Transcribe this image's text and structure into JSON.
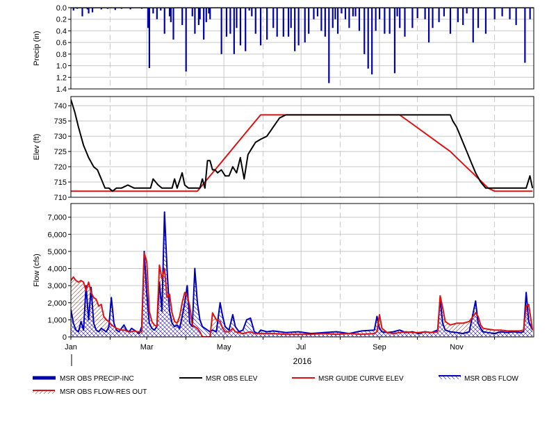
{
  "colors": {
    "precip": "#0000aa",
    "obs_elev": "#000000",
    "guide_curve": "#dd1111",
    "obs_flow": "#0000bb",
    "res_out": "#dd1111",
    "grid": "#c8c8c8"
  },
  "chart_data": [
    {
      "type": "bar",
      "ylabel": "Precip (in)",
      "ylim": [
        0.0,
        1.4
      ],
      "y_inverted": true,
      "yticks": [
        "0.0",
        "0.2",
        "0.4",
        "0.6",
        "0.8",
        "1.0",
        "1.2",
        "1.4"
      ],
      "grid": true,
      "series": [
        {
          "name": "MSR OBS PRECIP-INC",
          "x_day": [
            2,
            5,
            9,
            13,
            14,
            17,
            24,
            29,
            35,
            40,
            47,
            56,
            61,
            62,
            65,
            68,
            71,
            74,
            78,
            79,
            81,
            88,
            91,
            96,
            98,
            101,
            102,
            105,
            107,
            109,
            110,
            119,
            123,
            126,
            129,
            131,
            134,
            138,
            141,
            143,
            146,
            150,
            155,
            160,
            163,
            168,
            172,
            174,
            177,
            180,
            185,
            188,
            192,
            195,
            198,
            201,
            204,
            207,
            209,
            211,
            214,
            217,
            220,
            223,
            225,
            228,
            232,
            235,
            238,
            241,
            244,
            248,
            252,
            256,
            258,
            260,
            264,
            270,
            274,
            280,
            283,
            286,
            291,
            295,
            300,
            306,
            310,
            313,
            318,
            322,
            328,
            335,
            341,
            347,
            352,
            359,
            363
          ],
          "values": [
            0.05,
            0.02,
            0.15,
            0.03,
            0.1,
            0.08,
            0.03,
            0.02,
            0.04,
            0.02,
            0.03,
            0.02,
            0.35,
            1.04,
            0.1,
            0.2,
            0.05,
            0.45,
            0.15,
            0.25,
            0.55,
            0.3,
            1.1,
            0.15,
            0.45,
            0.3,
            0.2,
            0.55,
            0.25,
            0.1,
            0.2,
            0.8,
            0.5,
            0.45,
            0.8,
            0.35,
            0.65,
            0.75,
            0.05,
            0.15,
            0.45,
            0.65,
            0.55,
            0.35,
            0.5,
            0.5,
            0.5,
            0.35,
            0.75,
            0.65,
            0.6,
            0.45,
            0.2,
            0.15,
            0.4,
            0.5,
            1.3,
            0.35,
            0.2,
            0.45,
            0.1,
            0.2,
            0.35,
            0.15,
            0.15,
            0.4,
            0.8,
            1.05,
            1.15,
            0.4,
            0.2,
            0.45,
            0.45,
            1.13,
            0.15,
            0.35,
            0.5,
            0.35,
            0.18,
            0.2,
            0.6,
            0.35,
            0.25,
            0.15,
            0.45,
            0.25,
            0.3,
            0.1,
            0.6,
            0.35,
            0.45,
            0.2,
            0.15,
            0.2,
            0.3,
            0.95,
            0.2
          ]
        }
      ]
    },
    {
      "type": "line",
      "ylabel": "Elev (ft)",
      "ylim": [
        710,
        743
      ],
      "yticks": [
        "710",
        "715",
        "720",
        "725",
        "730",
        "735",
        "740"
      ],
      "grid": true,
      "series": [
        {
          "name": "MSR OBS ELEV",
          "x_day": [
            0,
            3,
            6,
            10,
            14,
            18,
            21,
            24,
            27,
            30,
            33,
            36,
            40,
            45,
            50,
            55,
            58,
            60,
            63,
            65,
            69,
            72,
            75,
            78,
            80,
            82,
            84,
            88,
            90,
            93,
            96,
            99,
            102,
            104,
            106,
            108,
            110,
            112,
            114,
            116,
            119,
            122,
            125,
            128,
            131,
            134,
            137,
            140,
            143,
            146,
            150,
            155,
            160,
            165,
            170,
            180,
            200,
            220,
            240,
            245,
            250,
            260,
            270,
            280,
            290,
            300,
            302,
            305,
            308,
            311,
            314,
            317,
            320,
            324,
            328,
            332,
            336,
            340,
            344,
            348,
            352,
            356,
            360,
            363,
            365
          ],
          "values": [
            742,
            738,
            733,
            727,
            723,
            720,
            719,
            716,
            713,
            713,
            712,
            713,
            713,
            714,
            713,
            713,
            713,
            713,
            713,
            716,
            714,
            713,
            713,
            713,
            713,
            716,
            713,
            718,
            714,
            713,
            713,
            713,
            713,
            716,
            713,
            722,
            722,
            719,
            719,
            718,
            719,
            717,
            717,
            720,
            718,
            723,
            716,
            724,
            726,
            728,
            729,
            730,
            733,
            736,
            737,
            737,
            737,
            737,
            737,
            737,
            737,
            737,
            737,
            737,
            737,
            737,
            735,
            733,
            730,
            727,
            724,
            721,
            718,
            715,
            713,
            713,
            713,
            713,
            713,
            713,
            713,
            713,
            713,
            717,
            713
          ]
        },
        {
          "name": "MSR GUIDE CURVE ELEV",
          "x_day": [
            0,
            90,
            100,
            110,
            120,
            130,
            140,
            150,
            160,
            170,
            180,
            200,
            220,
            240,
            260,
            270,
            280,
            290,
            300,
            310,
            320,
            330,
            335,
            340,
            365
          ],
          "values": [
            712,
            712,
            712,
            717,
            722,
            727,
            732,
            737,
            737,
            737,
            737,
            737,
            737,
            737,
            737,
            734,
            731,
            728,
            725,
            721,
            717,
            713,
            712,
            712,
            712
          ]
        }
      ]
    },
    {
      "type": "area",
      "ylabel": "Flow (cfs)",
      "xlabel": "2016",
      "ylim": [
        0,
        7800
      ],
      "yticks": [
        "0",
        "1,000",
        "2,000",
        "3,000",
        "4,000",
        "5,000",
        "6,000",
        "7,000"
      ],
      "xticks": [
        "Jan",
        "Mar",
        "May",
        "Jul",
        "Sep",
        "Nov"
      ],
      "x_month_days": [
        0,
        31,
        60,
        91,
        121,
        152,
        182,
        213,
        244,
        274,
        305,
        335
      ],
      "grid": true,
      "series": [
        {
          "name": "MSR OBS FLOW",
          "x_day": [
            0,
            2,
            4,
            6,
            8,
            10,
            12,
            14,
            16,
            18,
            20,
            22,
            24,
            26,
            28,
            30,
            32,
            34,
            36,
            38,
            40,
            42,
            44,
            46,
            48,
            50,
            52,
            54,
            56,
            58,
            60,
            62,
            64,
            66,
            68,
            70,
            72,
            74,
            76,
            78,
            80,
            82,
            84,
            86,
            88,
            90,
            92,
            94,
            96,
            98,
            100,
            102,
            104,
            106,
            108,
            110,
            112,
            115,
            118,
            120,
            122,
            125,
            128,
            130,
            133,
            136,
            139,
            142,
            145,
            148,
            150,
            155,
            160,
            170,
            180,
            190,
            200,
            210,
            220,
            230,
            240,
            242,
            244,
            246,
            250,
            255,
            260,
            265,
            270,
            275,
            280,
            285,
            290,
            292,
            294,
            296,
            300,
            305,
            310,
            315,
            320,
            322,
            324,
            326,
            330,
            335,
            340,
            345,
            350,
            355,
            358,
            360,
            362,
            365
          ],
          "values": [
            1600,
            800,
            400,
            300,
            900,
            400,
            3000,
            1000,
            2900,
            800,
            400,
            300,
            500,
            400,
            300,
            600,
            2300,
            800,
            400,
            300,
            500,
            700,
            400,
            300,
            500,
            400,
            300,
            200,
            600,
            5000,
            2500,
            800,
            500,
            400,
            600,
            3200,
            1500,
            7300,
            4000,
            1500,
            800,
            600,
            700,
            500,
            1200,
            2000,
            3000,
            800,
            600,
            4000,
            2000,
            1000,
            600,
            500,
            400,
            300,
            400,
            300,
            2000,
            1200,
            600,
            400,
            1300,
            600,
            300,
            400,
            1000,
            1100,
            300,
            200,
            400,
            300,
            350,
            250,
            300,
            200,
            250,
            300,
            200,
            350,
            400,
            1200,
            500,
            300,
            250,
            300,
            400,
            250,
            300,
            200,
            300,
            250,
            400,
            2200,
            800,
            400,
            300,
            250,
            200,
            300,
            2100,
            800,
            500,
            300,
            250,
            200,
            300,
            250,
            300,
            250,
            300,
            2600,
            900,
            400
          ]
        },
        {
          "name": "MSR OBS FLOW-RES OUT",
          "x_day": [
            0,
            2,
            4,
            6,
            8,
            10,
            12,
            14,
            16,
            18,
            20,
            22,
            24,
            26,
            28,
            30,
            32,
            34,
            36,
            38,
            40,
            42,
            44,
            46,
            48,
            50,
            52,
            54,
            56,
            58,
            60,
            62,
            64,
            66,
            68,
            70,
            72,
            74,
            76,
            78,
            80,
            82,
            84,
            86,
            88,
            90,
            92,
            94,
            96,
            98,
            100,
            102,
            104,
            106,
            108,
            110,
            112,
            115,
            118,
            120,
            122,
            125,
            128,
            130,
            133,
            136,
            139,
            142,
            145,
            148,
            150,
            155,
            160,
            170,
            180,
            190,
            200,
            210,
            220,
            230,
            240,
            242,
            244,
            246,
            250,
            255,
            260,
            265,
            270,
            275,
            280,
            285,
            290,
            292,
            294,
            296,
            300,
            305,
            310,
            315,
            320,
            322,
            324,
            326,
            330,
            335,
            340,
            345,
            350,
            355,
            358,
            360,
            362,
            365
          ],
          "values": [
            3300,
            3500,
            3300,
            3200,
            3300,
            3200,
            2700,
            3200,
            2600,
            2300,
            2200,
            1800,
            1900,
            1200,
            1000,
            900,
            700,
            600,
            500,
            450,
            400,
            400,
            350,
            300,
            300,
            350,
            300,
            300,
            300,
            4900,
            4400,
            1500,
            900,
            700,
            600,
            4200,
            3400,
            4000,
            2300,
            2500,
            1400,
            900,
            800,
            1200,
            2000,
            2600,
            2400,
            1800,
            700,
            600,
            500,
            300,
            0,
            0,
            0,
            0,
            1400,
            1000,
            900,
            500,
            300,
            300,
            500,
            300,
            250,
            200,
            250,
            300,
            200,
            200,
            200,
            200,
            200,
            150,
            150,
            150,
            200,
            150,
            200,
            150,
            200,
            300,
            1300,
            500,
            250,
            200,
            250,
            300,
            250,
            250,
            300,
            250,
            300,
            2400,
            1700,
            900,
            700,
            800,
            800,
            900,
            1400,
            1200,
            700,
            500,
            450,
            400,
            400,
            350,
            350,
            350,
            400,
            1800,
            1900,
            400
          ]
        }
      ]
    }
  ],
  "legend": {
    "items": [
      {
        "label": "MSR OBS PRECIP-INC"
      },
      {
        "label": "MSR OBS ELEV"
      },
      {
        "label": "MSR GUIDE CURVE ELEV"
      },
      {
        "label": "MSR OBS FLOW"
      },
      {
        "label": "MSR OBS FLOW-RES OUT"
      }
    ]
  }
}
